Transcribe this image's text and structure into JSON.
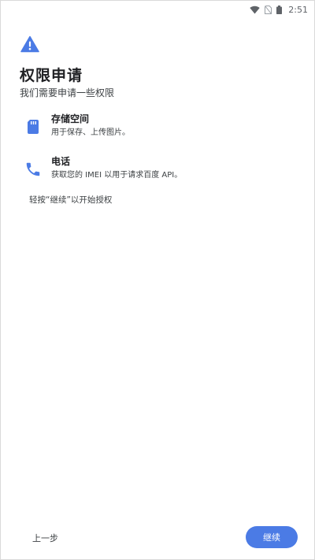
{
  "status_bar": {
    "time": "2:51",
    "icons": [
      "wifi-icon",
      "no-sim-icon",
      "battery-icon"
    ]
  },
  "header": {
    "icon": "warning-icon",
    "title": "权限申请",
    "subtitle": "我们需要申请一些权限"
  },
  "permissions": [
    {
      "icon": "sd-card-icon",
      "name": "存储空间",
      "description": "用于保存、上传图片。"
    },
    {
      "icon": "phone-icon",
      "name": "电话",
      "description": "获取您的 IMEI 以用于请求百度 API。"
    }
  ],
  "hint": "轻按“继续”以开始授权",
  "footer": {
    "back_label": "上一步",
    "continue_label": "继续"
  },
  "colors": {
    "accent": "#4b7be5",
    "background": "#ffffff",
    "text_primary": "#202124",
    "text_secondary": "#3c4043"
  }
}
